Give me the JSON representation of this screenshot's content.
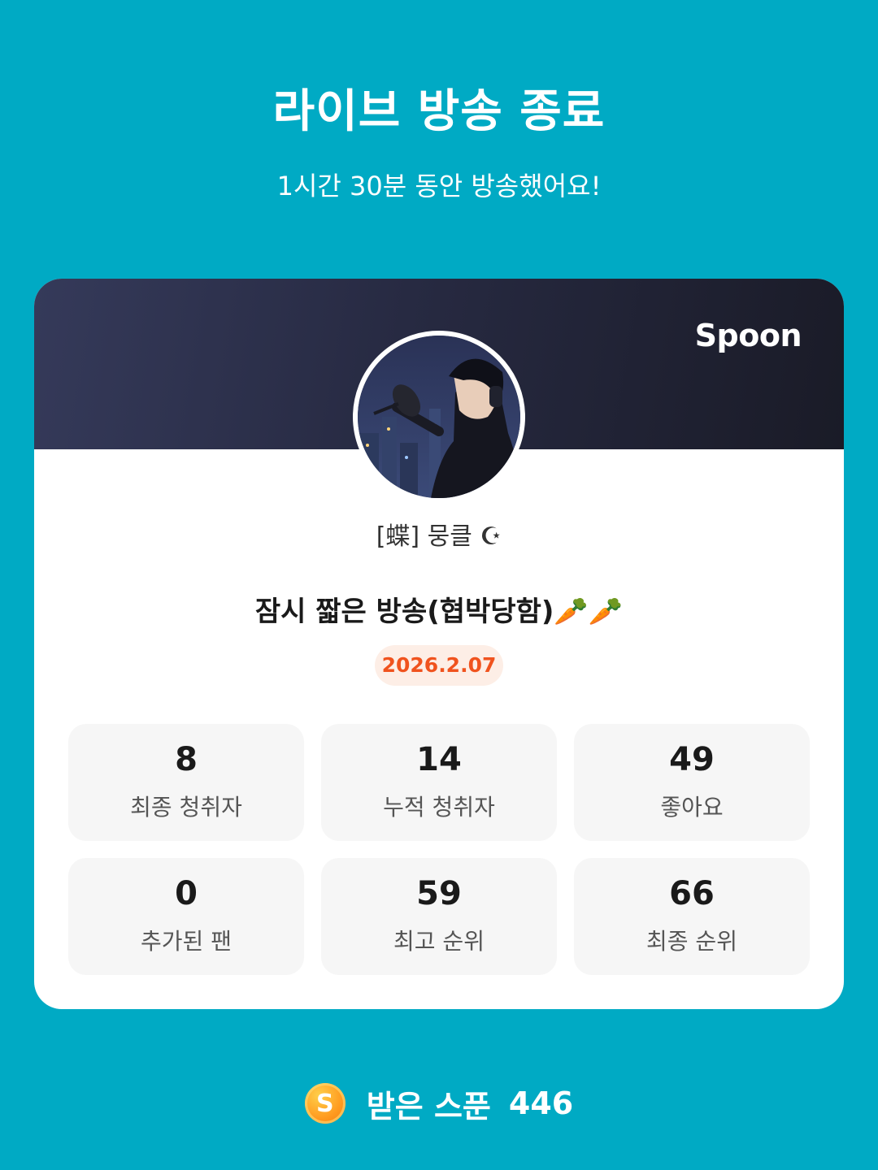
{
  "header": {
    "title": "라이브 방송 종료",
    "subtitle": "1시간 30분 동안 방송했어요!"
  },
  "card": {
    "brand": "Spoon",
    "username": "[蝶] 뭉클 ☪",
    "stream_title": "잠시 짧은 방송(협박당함)🥕🥕",
    "date": "2026.2.07",
    "stats": [
      {
        "value": "8",
        "label": "최종 청취자"
      },
      {
        "value": "14",
        "label": "누적 청취자"
      },
      {
        "value": "49",
        "label": "좋아요"
      },
      {
        "value": "0",
        "label": "추가된 팬"
      },
      {
        "value": "59",
        "label": "최고 순위"
      },
      {
        "value": "66",
        "label": "최종 순위"
      }
    ]
  },
  "footer": {
    "coin_letter": "S",
    "label": "받은 스푼",
    "value": "446"
  },
  "colors": {
    "background": "#00aac4",
    "date_accent": "#f0531e",
    "coin": "#ff9a1f"
  }
}
